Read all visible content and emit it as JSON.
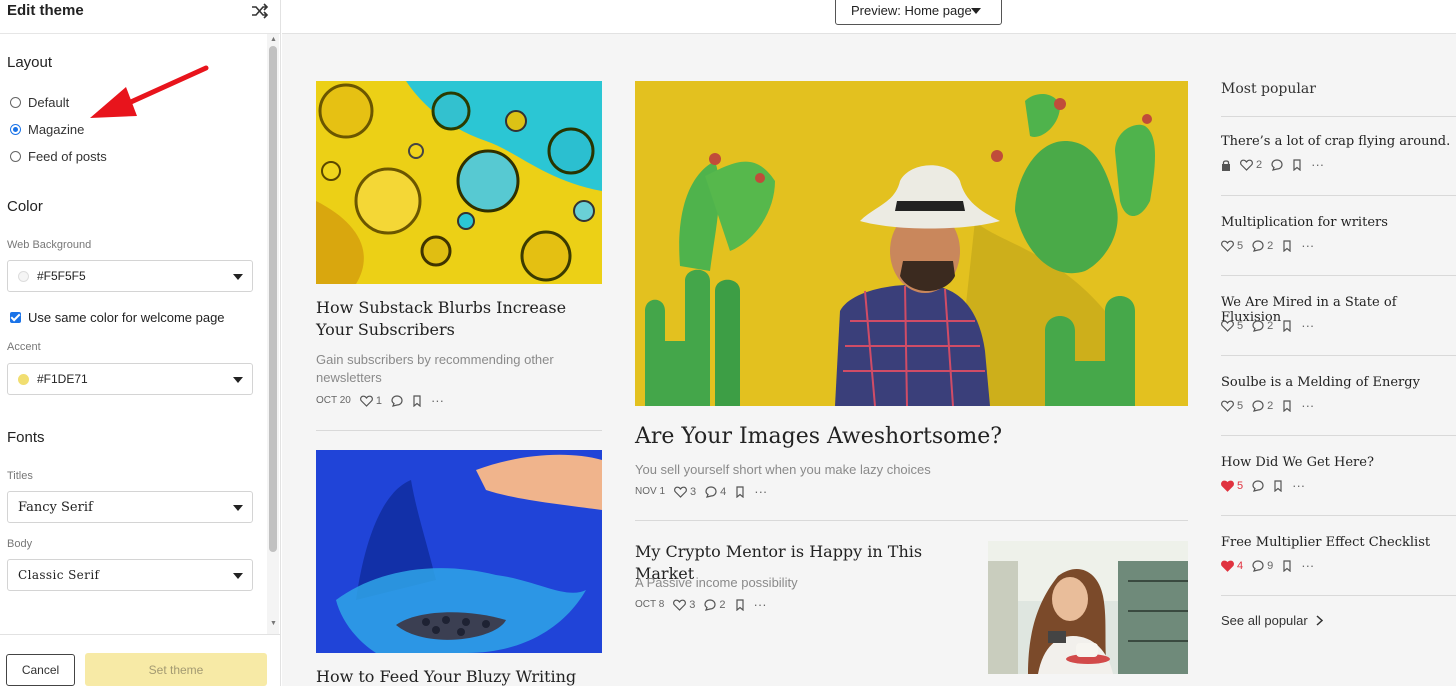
{
  "sidebar": {
    "title": "Edit theme",
    "layout": {
      "heading": "Layout",
      "options": [
        {
          "label": "Default",
          "selected": false
        },
        {
          "label": "Magazine",
          "selected": true
        },
        {
          "label": "Feed of posts",
          "selected": false
        }
      ]
    },
    "color": {
      "heading": "Color",
      "web_bg_label": "Web Background",
      "web_bg_value": "#F5F5F5",
      "same_color_label": "Use same color for welcome page",
      "same_color_checked": true,
      "accent_label": "Accent",
      "accent_value": "#F1DE71"
    },
    "fonts": {
      "heading": "Fonts",
      "titles_label": "Titles",
      "titles_value": "Fancy Serif",
      "body_label": "Body",
      "body_value": "Classic Serif"
    },
    "cancel_label": "Cancel",
    "set_label": "Set theme"
  },
  "preview": {
    "label": "Preview: Home page"
  },
  "posts": {
    "left": [
      {
        "title": "How Substack Blurbs Increase Your Subscribers",
        "subtitle": "Gain subscribers by recommending other newsletters",
        "date": "OCT 20",
        "likes": "1"
      },
      {
        "title": "How to Feed Your Bluzy Writing"
      }
    ],
    "feature": {
      "title": "Are Your Images Aweshortsome?",
      "subtitle": "You sell yourself short when you make lazy choices",
      "date": "NOV 1",
      "likes": "3",
      "comments": "4"
    },
    "second": {
      "title": "My Crypto Mentor is Happy in This Market",
      "subtitle": "A Passive income possibility",
      "date": "OCT 8",
      "likes": "3",
      "comments": "2"
    }
  },
  "most_popular": {
    "heading": "Most popular",
    "items": [
      {
        "title": "There’s a lot of crap flying around.",
        "likes": "2",
        "comments": "",
        "locked": true,
        "liked": false
      },
      {
        "title": "Multiplication for writers",
        "likes": "5",
        "comments": "2",
        "locked": false,
        "liked": false
      },
      {
        "title": "We Are Mired in a State of Fluxision",
        "likes": "5",
        "comments": "2",
        "locked": false,
        "liked": false
      },
      {
        "title": "Soulbe is a Melding of Energy",
        "likes": "5",
        "comments": "2",
        "locked": false,
        "liked": false
      },
      {
        "title": "How Did We Get Here?",
        "likes": "5",
        "comments": "",
        "locked": false,
        "liked": true
      },
      {
        "title": "Free Multiplier Effect Checklist",
        "likes": "4",
        "comments": "9",
        "locked": false,
        "liked": true
      }
    ],
    "see_all": "See all popular"
  },
  "colors": {
    "accent": "#F1DE71",
    "web_bg": "#F5F5F5",
    "arrow": "#e8141c",
    "radio": "#1a73e8",
    "liked": "#e0323f"
  },
  "icons": [
    "shuffle-icon",
    "heart-icon",
    "comment-icon",
    "bookmark-icon",
    "more-icon",
    "lock-icon",
    "chevron-right-icon",
    "caret-down-icon"
  ]
}
